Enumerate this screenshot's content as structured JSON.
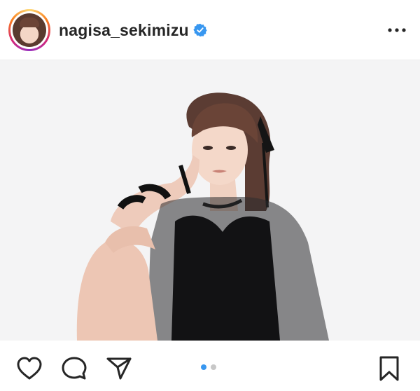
{
  "post": {
    "username": "nagisa_sekimizu",
    "verified": true,
    "more_icon": "more-horizontal-icon",
    "carousel": {
      "total_images": 2,
      "current_index": 1
    }
  },
  "actions": {
    "like_icon": "heart-icon",
    "comment_icon": "comment-icon",
    "share_icon": "paper-plane-icon",
    "save_icon": "bookmark-icon"
  },
  "colors": {
    "text": "#262626",
    "verified": "#3897f0",
    "dot_active": "#3897f0",
    "dot_inactive": "#c7c7c7",
    "photo_bg": "#f4f4f5"
  }
}
